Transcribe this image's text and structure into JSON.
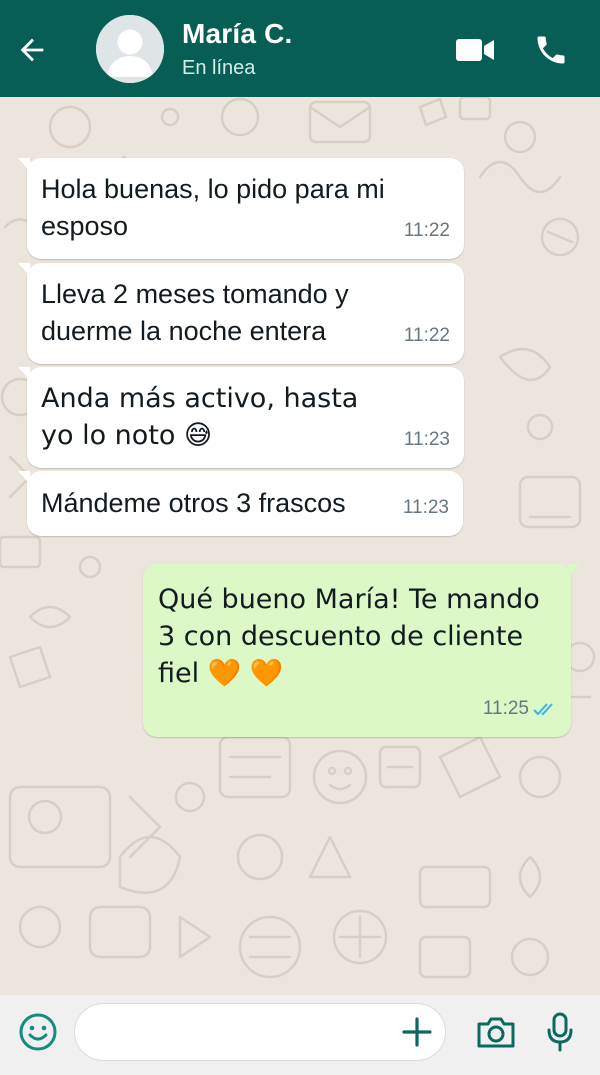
{
  "header": {
    "contact_name": "María C.",
    "status": "En línea",
    "back_icon": "arrow-back-icon",
    "avatar_icon": "default-avatar-icon",
    "video_icon": "video-call-icon",
    "phone_icon": "phone-call-icon",
    "bg_color": "#075e54"
  },
  "messages": [
    {
      "direction": "in",
      "text": "Hola buenas, lo pido para mi esposo",
      "time": "11:22"
    },
    {
      "direction": "in",
      "text": "Lleva 2 meses tomando y duerme la noche entera",
      "time": "11:22"
    },
    {
      "direction": "in",
      "text": "Anda más activo, hasta yo lo noto 😅",
      "time": "11:23"
    },
    {
      "direction": "in",
      "text": "Mándeme otros 3 frascos",
      "time": "11:23"
    },
    {
      "direction": "out",
      "text": "Qué bueno María! Te mando 3 con descuento de cliente fiel 🧡 🧡",
      "time": "11:25",
      "read": true
    }
  ],
  "composer": {
    "placeholder": "",
    "emoji_icon": "emoji-icon",
    "attach_icon": "plus-icon",
    "camera_icon": "camera-icon",
    "mic_icon": "mic-icon"
  },
  "colors": {
    "incoming_bubble": "#ffffff",
    "outgoing_bubble": "#dcf8c6",
    "chat_background": "#ece5dd",
    "read_ticks": "#34b7f1"
  }
}
